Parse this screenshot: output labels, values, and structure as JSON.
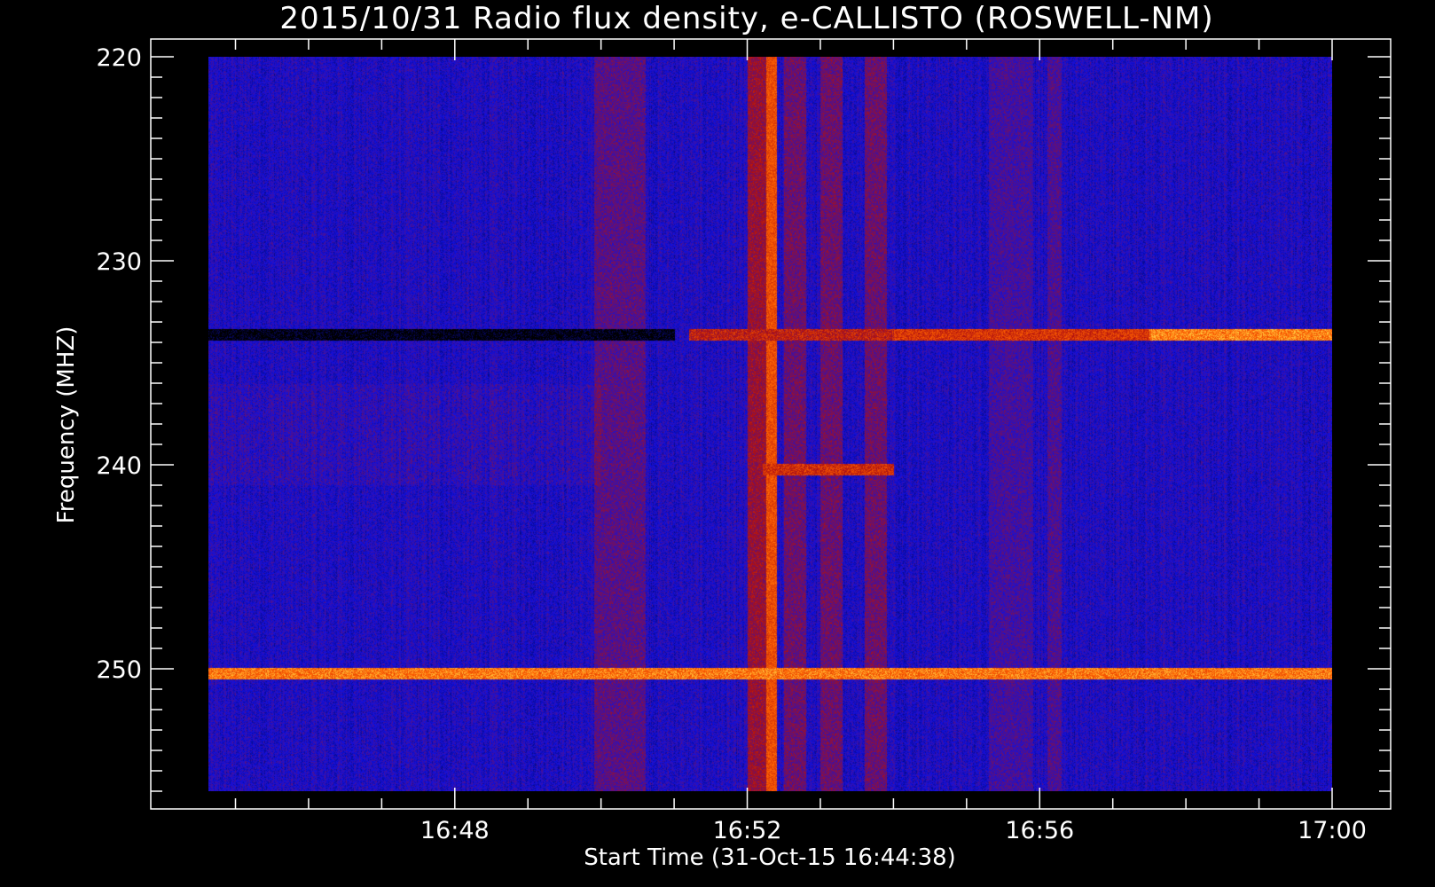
{
  "chart_data": {
    "type": "heatmap",
    "title": "2015/10/31  Radio flux density, e-CALLISTO (ROSWELL-NM)",
    "xlabel": "Start Time (31-Oct-15 16:44:38)",
    "ylabel": "Frequency (MHZ)",
    "x_ticks": [
      "16:48",
      "16:52",
      "16:56",
      "17:00"
    ],
    "x_tick_minutes": [
      48,
      52,
      56,
      60
    ],
    "x_range_minutes": [
      44.63,
      60.0
    ],
    "y_ticks": [
      220,
      230,
      240,
      250
    ],
    "y_range": [
      218.9,
      257.4
    ],
    "data_range": {
      "time_minutes": [
        44.63,
        60.0
      ],
      "frequency_mhz": [
        220,
        256
      ]
    },
    "colormap": {
      "low": "#000000",
      "mid_low": "#1010e0",
      "mid": "#b01010",
      "high": "#ff6000",
      "peak": "#ffff60"
    },
    "features": {
      "horizontal_bands_mhz": [
        {
          "frequency": 233.6,
          "segments": [
            {
              "t0": 44.63,
              "t1": 51.0,
              "level": 0.0
            },
            {
              "t0": 51.2,
              "t1": 54.0,
              "level": 0.55
            },
            {
              "t0": 54.0,
              "t1": 57.5,
              "level": 0.62
            },
            {
              "t0": 57.5,
              "t1": 60.0,
              "level": 0.8
            }
          ]
        },
        {
          "frequency": 250.2,
          "segments": [
            {
              "t0": 44.63,
              "t1": 60.0,
              "level": 0.78
            }
          ]
        },
        {
          "frequency": 240.2,
          "segments": [
            {
              "t0": 52.2,
              "t1": 54.0,
              "level": 0.6
            }
          ]
        }
      ],
      "vertical_bands_minutes": [
        {
          "t0": 49.9,
          "t1": 50.6,
          "level": 0.42
        },
        {
          "t0": 51.6,
          "t1": 51.9,
          "level": 0.08
        },
        {
          "t0": 52.0,
          "t1": 52.3,
          "level": 0.52
        },
        {
          "t0": 52.25,
          "t1": 52.4,
          "level": 0.75
        },
        {
          "t0": 52.5,
          "t1": 52.8,
          "level": 0.45
        },
        {
          "t0": 53.0,
          "t1": 53.3,
          "level": 0.45
        },
        {
          "t0": 53.6,
          "t1": 53.9,
          "level": 0.45
        },
        {
          "t0": 55.3,
          "t1": 55.9,
          "level": 0.38
        },
        {
          "t0": 56.1,
          "t1": 56.3,
          "level": 0.4
        }
      ]
    }
  },
  "colors": {
    "background": "#000000",
    "axis": "#ffffff",
    "background_field": "#2020d8"
  }
}
